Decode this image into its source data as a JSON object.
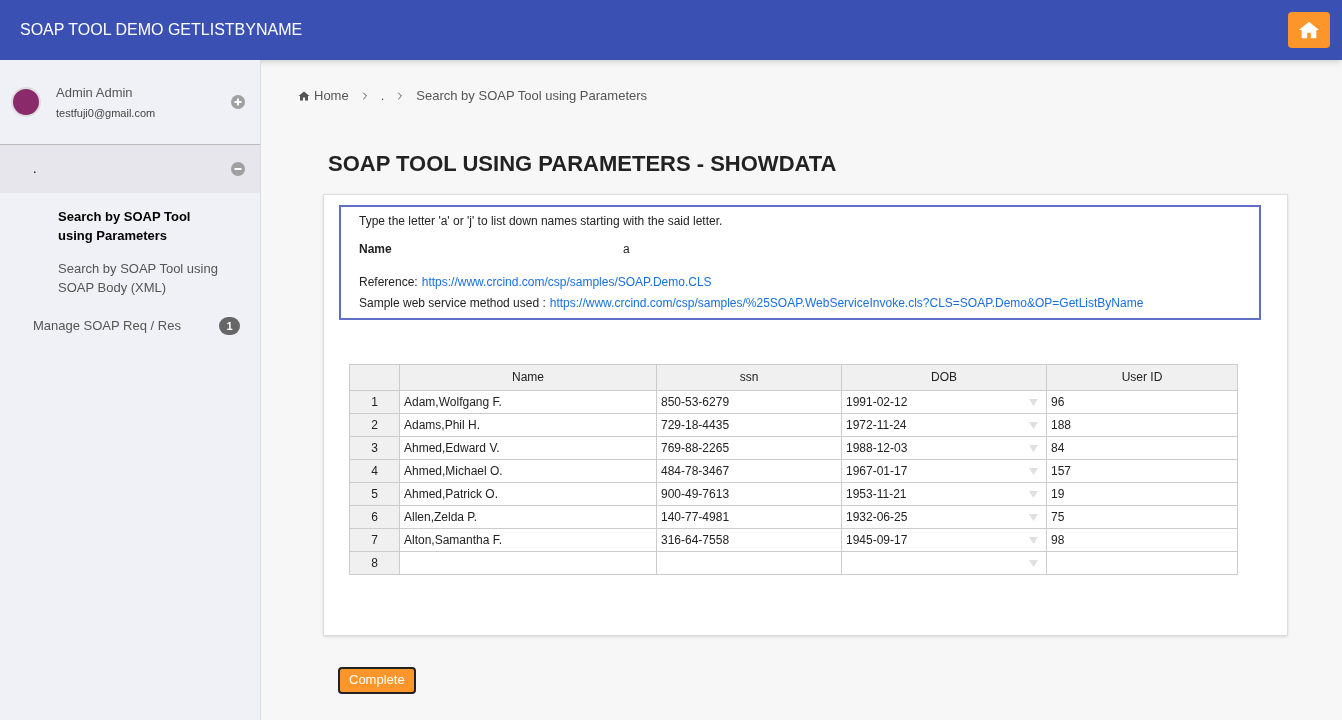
{
  "header": {
    "title": "SOAP TOOL DEMO GETLISTBYNAME"
  },
  "sidebar": {
    "user": {
      "name": "Admin Admin",
      "email": "testfuji0@gmail.com"
    },
    "items": [
      {
        "label": ".",
        "expanded": true,
        "children": [
          {
            "label": "Search by SOAP Tool using Parameters",
            "selected": true
          },
          {
            "label": "Search by SOAP Tool using SOAP Body (XML)",
            "selected": false
          }
        ]
      },
      {
        "label": "Manage SOAP Req / Res",
        "badge": "1"
      }
    ]
  },
  "breadcrumb": [
    "Home",
    ".",
    "Search by SOAP Tool using Parameters"
  ],
  "page_title": "SOAP TOOL USING PARAMETERS - SHOWDATA",
  "info": {
    "instruction": "Type the letter 'a' or 'j' to list down names starting with the said letter.",
    "name_label": "Name",
    "name_value": "a",
    "reference_label": "Reference:",
    "reference_link": "https://www.crcind.com/csp/samples/SOAP.Demo.CLS",
    "method_label": "Sample web service method used :",
    "method_link": "https://www.crcind.com/csp/samples/%25SOAP.WebServiceInvoke.cls?CLS=SOAP.Demo&OP=GetListByName"
  },
  "table": {
    "columns": [
      "Name",
      "ssn",
      "DOB",
      "User ID"
    ],
    "rows": [
      {
        "num": "1",
        "cells": [
          "Adam,Wolfgang F.",
          "850-53-6279",
          "1991-02-12",
          "96"
        ]
      },
      {
        "num": "2",
        "cells": [
          "Adams,Phil H.",
          "729-18-4435",
          "1972-11-24",
          "188"
        ]
      },
      {
        "num": "3",
        "cells": [
          "Ahmed,Edward V.",
          "769-88-2265",
          "1988-12-03",
          "84"
        ]
      },
      {
        "num": "4",
        "cells": [
          "Ahmed,Michael O.",
          "484-78-3467",
          "1967-01-17",
          "157"
        ]
      },
      {
        "num": "5",
        "cells": [
          "Ahmed,Patrick O.",
          "900-49-7613",
          "1953-11-21",
          "19"
        ]
      },
      {
        "num": "6",
        "cells": [
          "Allen,Zelda P.",
          "140-77-4981",
          "1932-06-25",
          "75"
        ]
      },
      {
        "num": "7",
        "cells": [
          "Alton,Samantha F.",
          "316-64-7558",
          "1945-09-17",
          "98"
        ]
      },
      {
        "num": "8",
        "cells": [
          "",
          "",
          "",
          ""
        ]
      }
    ]
  },
  "complete_button": "Complete"
}
